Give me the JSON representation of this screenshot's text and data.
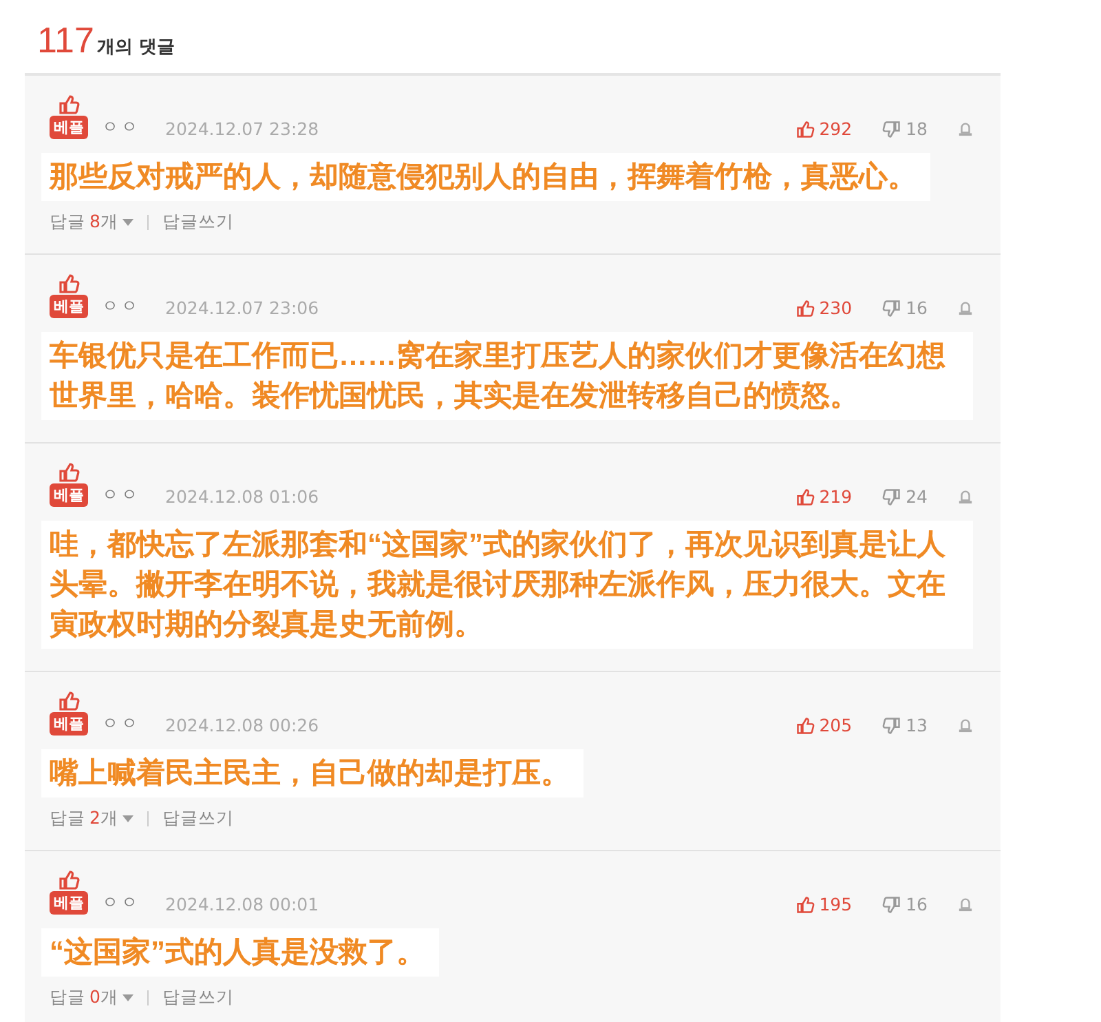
{
  "header": {
    "count": "117",
    "label": "개의 댓글"
  },
  "comments": [
    {
      "badge": "베플",
      "author": "ㅇㅇ",
      "date": "2024.12.07 23:28",
      "likes": "292",
      "dislikes": "18",
      "text": "那些反对戒严的人，却随意侵犯别人的自由，挥舞着竹枪，真恶心。",
      "replies": {
        "label": "답글",
        "count": "8",
        "unit": "개",
        "write": "답글쓰기"
      }
    },
    {
      "badge": "베플",
      "author": "ㅇㅇ",
      "date": "2024.12.07 23:06",
      "likes": "230",
      "dislikes": "16",
      "text": "车银优只是在工作而已……窝在家里打压艺人的家伙们才更像活在幻想世界里，哈哈。装作忧国忧民，其实是在发泄转移自己的愤怒。"
    },
    {
      "badge": "베플",
      "author": "ㅇㅇ",
      "date": "2024.12.08 01:06",
      "likes": "219",
      "dislikes": "24",
      "text": "哇，都快忘了左派那套和“这国家”式的家伙们了，再次见识到真是让人头晕。撇开李在明不说，我就是很讨厌那种左派作风，压力很大。文在寅政权时期的分裂真是史无前例。"
    },
    {
      "badge": "베플",
      "author": "ㅇㅇ",
      "date": "2024.12.08 00:26",
      "likes": "205",
      "dislikes": "13",
      "text": "嘴上喊着民主民主，自己做的却是打压。",
      "replies": {
        "label": "답글",
        "count": "2",
        "unit": "개",
        "write": "답글쓰기"
      }
    },
    {
      "badge": "베플",
      "author": "ㅇㅇ",
      "date": "2024.12.08 00:01",
      "likes": "195",
      "dislikes": "16",
      "text": "“这国家”式的人真是没救了。",
      "replies": {
        "label": "답글",
        "count": "0",
        "unit": "개",
        "write": "답글쓰기"
      }
    }
  ]
}
